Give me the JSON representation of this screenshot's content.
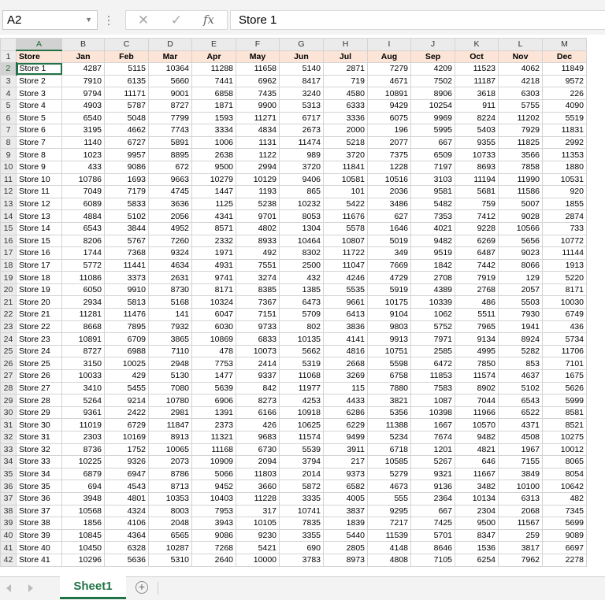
{
  "formula_bar": {
    "name_box": "A2",
    "content": "Store 1",
    "cancel_glyph": "✕",
    "enter_glyph": "✓",
    "fx_label": "fx"
  },
  "active_cell": "A2",
  "column_letters": [
    "A",
    "B",
    "C",
    "D",
    "E",
    "F",
    "G",
    "H",
    "I",
    "J",
    "K",
    "L",
    "M"
  ],
  "header_row": [
    "Store",
    "Jan",
    "Feb",
    "Mar",
    "Apr",
    "May",
    "Jun",
    "Jul",
    "Aug",
    "Sep",
    "Oct",
    "Nov",
    "Dec"
  ],
  "rows": [
    [
      "Store 1",
      4287,
      5115,
      10364,
      11288,
      11658,
      5140,
      2871,
      7279,
      4209,
      11523,
      4062,
      11849
    ],
    [
      "Store 2",
      7910,
      6135,
      5660,
      7441,
      6962,
      8417,
      719,
      4671,
      7502,
      11187,
      4218,
      9572
    ],
    [
      "Store 3",
      9794,
      11171,
      9001,
      6858,
      7435,
      3240,
      4580,
      10891,
      8906,
      3618,
      6303,
      226
    ],
    [
      "Store 4",
      4903,
      5787,
      8727,
      1871,
      9900,
      5313,
      6333,
      9429,
      10254,
      911,
      5755,
      4090
    ],
    [
      "Store 5",
      6540,
      5048,
      7799,
      1593,
      11271,
      6717,
      3336,
      6075,
      9969,
      8224,
      11202,
      5519
    ],
    [
      "Store 6",
      3195,
      4662,
      7743,
      3334,
      4834,
      2673,
      2000,
      196,
      5995,
      5403,
      7929,
      11831
    ],
    [
      "Store 7",
      1140,
      6727,
      5891,
      1006,
      1131,
      11474,
      5218,
      2077,
      667,
      9355,
      11825,
      2992
    ],
    [
      "Store 8",
      1023,
      9957,
      8895,
      2638,
      1122,
      989,
      3720,
      7375,
      6509,
      10733,
      3566,
      11353
    ],
    [
      "Store 9",
      433,
      9086,
      672,
      9500,
      2994,
      3720,
      11841,
      1228,
      7197,
      8693,
      7858,
      1880
    ],
    [
      "Store 10",
      10786,
      1693,
      9663,
      10279,
      10129,
      9406,
      10581,
      10516,
      3103,
      11194,
      11990,
      10531
    ],
    [
      "Store 11",
      7049,
      7179,
      4745,
      1447,
      1193,
      865,
      101,
      2036,
      9581,
      5681,
      11586,
      920
    ],
    [
      "Store 12",
      6089,
      5833,
      3636,
      1125,
      5238,
      10232,
      5422,
      3486,
      5482,
      759,
      5007,
      1855
    ],
    [
      "Store 13",
      4884,
      5102,
      2056,
      4341,
      9701,
      8053,
      11676,
      627,
      7353,
      7412,
      9028,
      2874
    ],
    [
      "Store 14",
      6543,
      3844,
      4952,
      8571,
      4802,
      1304,
      5578,
      1646,
      4021,
      9228,
      10566,
      733
    ],
    [
      "Store 15",
      8206,
      5767,
      7260,
      2332,
      8933,
      10464,
      10807,
      5019,
      9482,
      6269,
      5656,
      10772
    ],
    [
      "Store 16",
      1744,
      7368,
      9324,
      1971,
      492,
      8302,
      11722,
      349,
      9519,
      6487,
      9023,
      11144
    ],
    [
      "Store 17",
      5772,
      11441,
      4634,
      4931,
      7551,
      2500,
      11047,
      7669,
      1842,
      7442,
      8066,
      1913
    ],
    [
      "Store 18",
      11086,
      3373,
      2631,
      9741,
      3274,
      432,
      4246,
      4729,
      2708,
      7919,
      129,
      5220
    ],
    [
      "Store 19",
      6050,
      9910,
      8730,
      8171,
      8385,
      1385,
      5535,
      5919,
      4389,
      2768,
      2057,
      8171
    ],
    [
      "Store 20",
      2934,
      5813,
      5168,
      10324,
      7367,
      6473,
      9661,
      10175,
      10339,
      486,
      5503,
      10030
    ],
    [
      "Store 21",
      11281,
      11476,
      141,
      6047,
      7151,
      5709,
      6413,
      9104,
      1062,
      5511,
      7930,
      6749
    ],
    [
      "Store 22",
      8668,
      7895,
      7932,
      6030,
      9733,
      802,
      3836,
      9803,
      5752,
      7965,
      1941,
      436
    ],
    [
      "Store 23",
      10891,
      6709,
      3865,
      10869,
      6833,
      10135,
      4141,
      9913,
      7971,
      9134,
      8924,
      5734
    ],
    [
      "Store 24",
      8727,
      6988,
      7110,
      478,
      10073,
      5662,
      4816,
      10751,
      2585,
      4995,
      5282,
      11706
    ],
    [
      "Store 25",
      3150,
      10025,
      2948,
      7753,
      2414,
      5319,
      2668,
      5598,
      6472,
      7850,
      853,
      7101
    ],
    [
      "Store 26",
      10033,
      429,
      5130,
      1477,
      9337,
      11068,
      3269,
      6758,
      11853,
      11574,
      4637,
      1675
    ],
    [
      "Store 27",
      3410,
      5455,
      7080,
      5639,
      842,
      11977,
      115,
      7880,
      7583,
      8902,
      5102,
      5626
    ],
    [
      "Store 28",
      5264,
      9214,
      10780,
      6906,
      8273,
      4253,
      4433,
      3821,
      1087,
      7044,
      6543,
      5999
    ],
    [
      "Store 29",
      9361,
      2422,
      2981,
      1391,
      6166,
      10918,
      6286,
      5356,
      10398,
      11966,
      6522,
      8581
    ],
    [
      "Store 30",
      11019,
      6729,
      11847,
      2373,
      426,
      10625,
      6229,
      11388,
      1667,
      10570,
      4371,
      8521
    ],
    [
      "Store 31",
      2303,
      10169,
      8913,
      11321,
      9683,
      11574,
      9499,
      5234,
      7674,
      9482,
      4508,
      10275
    ],
    [
      "Store 32",
      8736,
      1752,
      10065,
      11168,
      6730,
      5539,
      3911,
      6718,
      1201,
      4821,
      1967,
      10012
    ],
    [
      "Store 33",
      10225,
      9326,
      2073,
      10909,
      2094,
      3794,
      217,
      10585,
      5267,
      646,
      7155,
      8065
    ],
    [
      "Store 34",
      6879,
      6947,
      8786,
      5066,
      11803,
      2014,
      9373,
      5279,
      9321,
      11667,
      3849,
      8054
    ],
    [
      "Store 35",
      694,
      4543,
      8713,
      9452,
      3660,
      5872,
      6582,
      4673,
      9136,
      3482,
      10100,
      10642
    ],
    [
      "Store 36",
      3948,
      4801,
      10353,
      10403,
      11228,
      3335,
      4005,
      555,
      2364,
      10134,
      6313,
      482
    ],
    [
      "Store 37",
      10568,
      4324,
      8003,
      7953,
      317,
      10741,
      3837,
      9295,
      667,
      2304,
      2068,
      7345
    ],
    [
      "Store 38",
      1856,
      4106,
      2048,
      3943,
      10105,
      7835,
      1839,
      7217,
      7425,
      9500,
      11567,
      5699
    ],
    [
      "Store 39",
      10845,
      4364,
      6565,
      9086,
      9230,
      3355,
      5440,
      11539,
      5701,
      8347,
      259,
      9089
    ],
    [
      "Store 40",
      10450,
      6328,
      10287,
      7268,
      5421,
      690,
      2805,
      4148,
      8646,
      1536,
      3817,
      6697
    ],
    [
      "Store 41",
      10296,
      5636,
      5310,
      2640,
      10000,
      3783,
      8973,
      4808,
      7105,
      6254,
      7962,
      2278
    ]
  ],
  "sheet_tabs": [
    {
      "label": "Sheet1",
      "active": true
    }
  ],
  "add_sheet_glyph": "+",
  "colors": {
    "accent": "#217346",
    "header_fill": "#fce4d6",
    "chrome": "#f3f3f3"
  }
}
